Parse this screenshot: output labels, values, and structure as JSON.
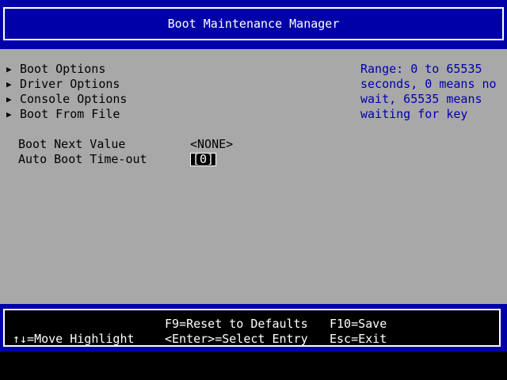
{
  "header": {
    "title": "Boot Maintenance Manager"
  },
  "menu": {
    "items": [
      {
        "label": "Boot Options",
        "icon": "right-triangle-icon"
      },
      {
        "label": "Driver Options",
        "icon": "right-triangle-icon"
      },
      {
        "label": "Console Options",
        "icon": "right-triangle-icon"
      },
      {
        "label": "Boot From File",
        "icon": "right-triangle-icon"
      }
    ]
  },
  "fields": {
    "boot_next": {
      "label": "Boot Next Value",
      "value": "<NONE>"
    },
    "auto_boot": {
      "label": "Auto Boot Time-out",
      "value": "[0]"
    }
  },
  "help": {
    "lines": [
      "Range: 0 to 65535",
      "seconds, 0 means no",
      "wait, 65535 means",
      "waiting for key"
    ]
  },
  "footer": {
    "move": "↑↓=Move Highlight",
    "reset": "F9=Reset to Defaults",
    "select": "<Enter>=Select Entry",
    "save": "F10=Save",
    "exit": "Esc=Exit"
  },
  "colors": {
    "background": "#a8a8a8",
    "band": "#0000a8",
    "help_text": "#0000a8",
    "footer_bg": "#000000",
    "text": "#000000",
    "highlight_bg": "#000000",
    "highlight_fg": "#ffffff"
  }
}
